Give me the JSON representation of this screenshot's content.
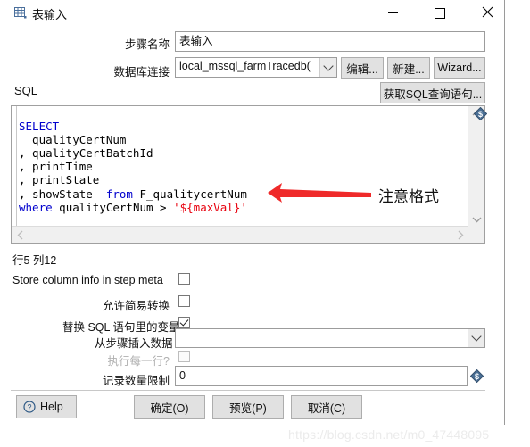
{
  "window": {
    "title": "表输入",
    "icon": "table-input-icon",
    "controls": {
      "minimize": "minimize-icon",
      "maximize": "maximize-icon",
      "close": "close-icon"
    }
  },
  "form": {
    "step_name_label": "步骤名称",
    "step_name_value": "表输入",
    "connection_label": "数据库连接",
    "connection_value": "local_mssql_farmTracedb(",
    "edit_button": "编辑...",
    "new_button": "新建...",
    "wizard_button": "Wizard..."
  },
  "sql": {
    "section_label": "SQL",
    "get_query_button": "获取SQL查询语句...",
    "lines": [
      {
        "tokens": [
          {
            "t": "SELECT",
            "c": "kw"
          }
        ]
      },
      {
        "tokens": [
          {
            "t": "  qualityCertNum",
            "c": ""
          }
        ]
      },
      {
        "tokens": [
          {
            "t": ", qualityCertBatchId",
            "c": ""
          }
        ]
      },
      {
        "tokens": [
          {
            "t": ", printTime",
            "c": ""
          }
        ]
      },
      {
        "tokens": [
          {
            "t": ", printState",
            "c": ""
          }
        ]
      },
      {
        "tokens": [
          {
            "t": ", showState  ",
            "c": ""
          },
          {
            "t": "from",
            "c": "kw"
          },
          {
            "t": " F_qualitycertNum",
            "c": ""
          }
        ]
      },
      {
        "tokens": [
          {
            "t": "where",
            "c": "kw"
          },
          {
            "t": " qualityCertNum > ",
            "c": ""
          },
          {
            "t": "'${maxVal}'",
            "c": "var"
          }
        ]
      }
    ],
    "plain_text": "SELECT\n  qualityCertNum\n, qualityCertBatchId\n, printTime\n, printState\n, showState  from F_qualitycertNum\nwhere qualityCertNum > '${maxVal}'",
    "caret_status": "行5 列12",
    "variable_marker": "$"
  },
  "annotation": {
    "text": "注意格式",
    "arrow_color": "#ef2a2a"
  },
  "options": {
    "store_column_info_label": "Store column info in step meta",
    "store_column_info_checked": false,
    "lazy_conversion_label": "允许简易转换",
    "lazy_conversion_checked": false,
    "replace_variables_label": "替换 SQL 语句里的变量",
    "replace_variables_checked": true,
    "insert_data_from_step_label": "从步骤插入数据",
    "insert_data_from_step_value": "",
    "execute_each_row_label": "执行每一行?",
    "execute_each_row_checked": false,
    "execute_each_row_disabled": true,
    "limit_size_label": "记录数量限制",
    "limit_size_value": "0"
  },
  "footer": {
    "help_label": "Help",
    "help_icon": "question-circle-icon",
    "ok_label": "确定(O)",
    "preview_label": "预览(P)",
    "cancel_label": "取消(C)"
  },
  "watermark": "https://blog.csdn.net/m0_47448095",
  "colors": {
    "keyword": "#0000cd",
    "variable": "#e8000d",
    "arrow": "#ef2a2a",
    "button_face": "#e1e1e1"
  }
}
